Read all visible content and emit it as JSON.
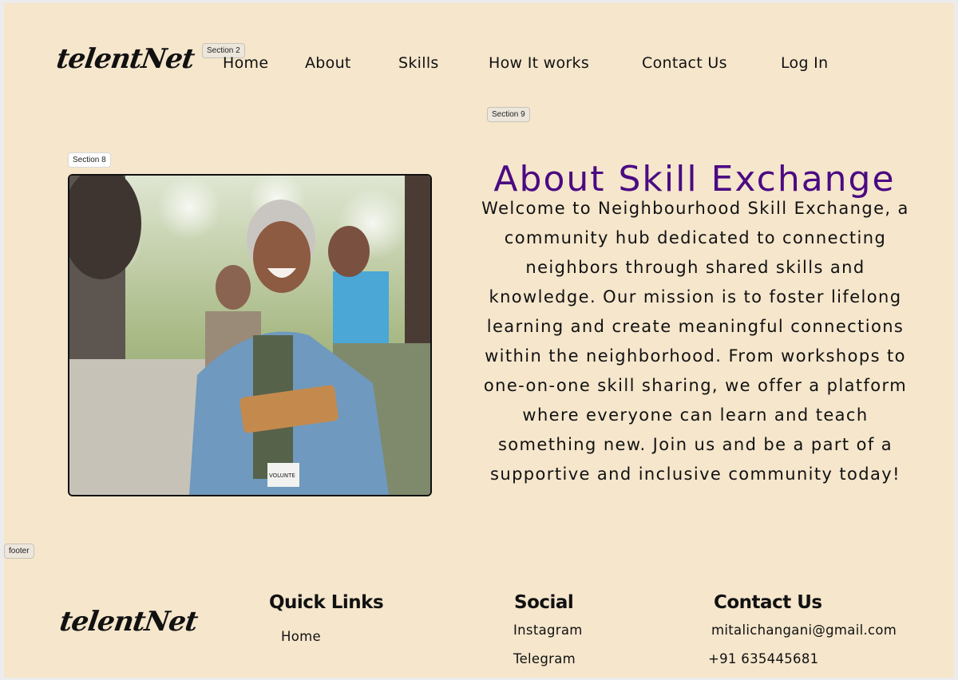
{
  "brand": {
    "logo_text": "telentNet"
  },
  "frame_labels": {
    "nav": "Section 2",
    "about": "Section 9",
    "image": "Section 8",
    "footer": "footer"
  },
  "nav": {
    "items": [
      {
        "label": "Home"
      },
      {
        "label": "About"
      },
      {
        "label": "Skills"
      },
      {
        "label": "How It works"
      },
      {
        "label": "Contact Us"
      },
      {
        "label": "Log In"
      }
    ]
  },
  "about": {
    "title": "About Skill Exchange",
    "body": "Welcome to Neighbourhood Skill Exchange, a community hub dedicated to connecting neighbors through shared skills and knowledge. Our mission is to foster lifelong learning and create meaningful connections within the neighborhood. From workshops to one-on-one skill sharing, we offer a platform where everyone can learn and teach something new. Join us and be a part of a supportive and inclusive community today!",
    "image_badge_text": "VOLUNTE"
  },
  "footer": {
    "logo_text": "telentNet",
    "quick_links": {
      "heading": "Quick Links",
      "items": [
        "Home"
      ]
    },
    "social": {
      "heading": "Social",
      "items": [
        "Instagram",
        "Telegram"
      ]
    },
    "contact": {
      "heading": "Contact Us",
      "email": "mitalichangani@gmail.com",
      "phone": "+91 635445681"
    }
  },
  "colors": {
    "page_background": "#f5e6cc",
    "title_purple": "#4b0a82",
    "text": "#111111"
  }
}
